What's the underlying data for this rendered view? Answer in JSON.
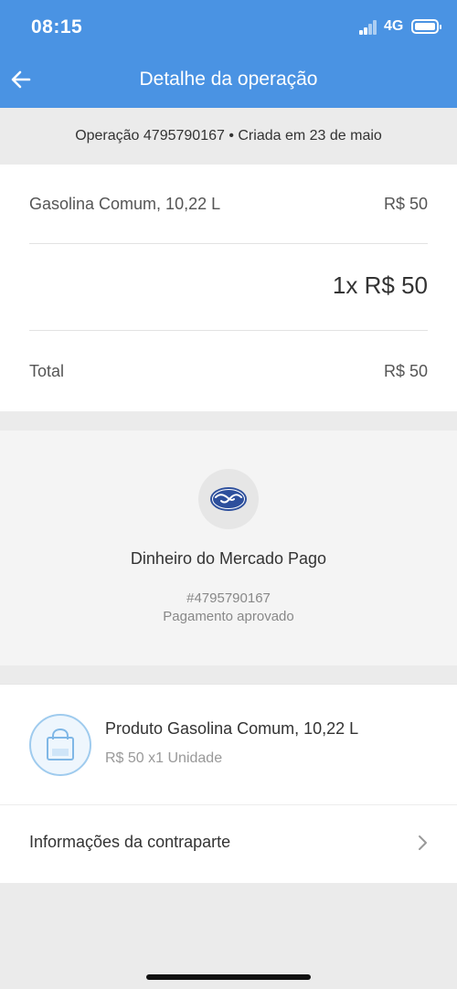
{
  "status_bar": {
    "time": "08:15",
    "network": "4G"
  },
  "header": {
    "title": "Detalhe da operação"
  },
  "operation": {
    "summary": "Operação 4795790167 • Criada em 23 de maio"
  },
  "items": {
    "item_label": "Gasolina Comum, 10,22 L",
    "item_price": "R$ 50",
    "quantity_price": "1x R$ 50",
    "total_label": "Total",
    "total_value": "R$ 50"
  },
  "payment": {
    "method": "Dinheiro do Mercado Pago",
    "id": "#4795790167",
    "status": "Pagamento aprovado"
  },
  "product": {
    "title": "Produto Gasolina Comum, 10,22 L",
    "subtitle": "R$ 50 x1 Unidade"
  },
  "counterpart": {
    "label": "Informações da contraparte"
  },
  "colors": {
    "header_bg": "#4a93e3",
    "mercadopago_blue": "#2d4f9c",
    "product_icon": "#9fcbee"
  }
}
